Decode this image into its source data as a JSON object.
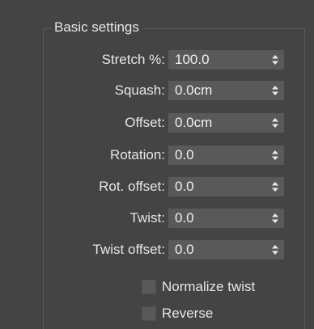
{
  "group": {
    "title": "Basic settings"
  },
  "fields": [
    {
      "label": "Stretch %:",
      "value": "100.0"
    },
    {
      "label": "Squash:",
      "value": "0.0cm"
    },
    {
      "label": "Offset:",
      "value": "0.0cm"
    },
    {
      "label": "Rotation:",
      "value": "0.0"
    },
    {
      "label": "Rot. offset:",
      "value": "0.0"
    },
    {
      "label": "Twist:",
      "value": "0.0"
    },
    {
      "label": "Twist offset:",
      "value": "0.0"
    }
  ],
  "checkboxes": [
    {
      "label": "Normalize twist",
      "checked": false
    },
    {
      "label": "Reverse",
      "checked": false
    }
  ],
  "icons": {
    "spinner": "up-down-arrows-icon"
  },
  "colors": {
    "panel_bg": "#444444",
    "field_bg": "#595959",
    "text": "#e6e6e6"
  }
}
